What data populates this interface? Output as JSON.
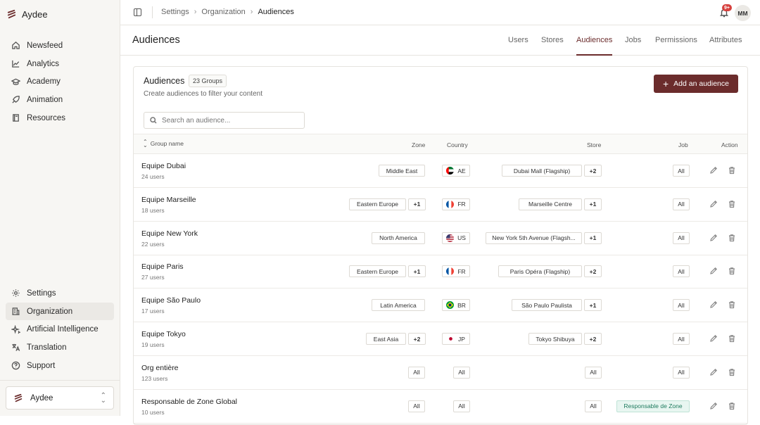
{
  "app": {
    "name": "Aydee"
  },
  "sidebar": {
    "top_items": [
      {
        "label": "Newsfeed",
        "icon": "home-icon"
      },
      {
        "label": "Analytics",
        "icon": "chart-icon"
      },
      {
        "label": "Academy",
        "icon": "graduation-cap-icon"
      },
      {
        "label": "Animation",
        "icon": "rocket-icon"
      },
      {
        "label": "Resources",
        "icon": "book-icon"
      }
    ],
    "bottom_items": [
      {
        "label": "Settings",
        "icon": "gear-icon"
      },
      {
        "label": "Organization",
        "icon": "building-icon",
        "active": true
      },
      {
        "label": "Artificial Intelligence",
        "icon": "sparkle-icon"
      },
      {
        "label": "Translation",
        "icon": "translate-icon"
      },
      {
        "label": "Support",
        "icon": "help-circle-icon"
      }
    ],
    "workspace": "Aydee"
  },
  "topbar": {
    "breadcrumb": [
      "Settings",
      "Organization",
      "Audiences"
    ],
    "notification_badge": "9+",
    "avatar_initials": "MM"
  },
  "page": {
    "title": "Audiences",
    "tabs": [
      {
        "label": "Users"
      },
      {
        "label": "Stores"
      },
      {
        "label": "Audiences",
        "active": true
      },
      {
        "label": "Jobs"
      },
      {
        "label": "Permissions"
      },
      {
        "label": "Attributes"
      }
    ]
  },
  "card": {
    "title": "Audiences",
    "count": "23 Groups",
    "subtitle": "Create audiences to filter your content",
    "add_button": "Add an audience",
    "search_placeholder": "Search an audience...",
    "columns": {
      "group": "Group name",
      "zone": "Zone",
      "country": "Country",
      "store": "Store",
      "job": "Job",
      "action": "Action"
    }
  },
  "colors": {
    "accent": "#6b2c2c",
    "badge": "#d6403d",
    "green_chip": "#e8f6f1"
  },
  "rows": [
    {
      "name": "Equipe Dubai",
      "users": "24 users",
      "zone": "Middle East",
      "zone_more": "",
      "country": "AE",
      "flag": "ae",
      "store": "Dubai Mall (Flagship)",
      "store_more": "+2",
      "job": "All"
    },
    {
      "name": "Equipe Marseille",
      "users": "18 users",
      "zone": "Eastern Europe",
      "zone_more": "+1",
      "country": "FR",
      "flag": "fr",
      "store": "Marseille Centre",
      "store_more": "+1",
      "job": "All"
    },
    {
      "name": "Equipe New York",
      "users": "22 users",
      "zone": "North America",
      "zone_more": "",
      "country": "US",
      "flag": "us",
      "store": "New York 5th Avenue (Flagsh...",
      "store_more": "+1",
      "job": "All"
    },
    {
      "name": "Equipe Paris",
      "users": "27 users",
      "zone": "Eastern Europe",
      "zone_more": "+1",
      "country": "FR",
      "flag": "fr",
      "store": "Paris Opéra (Flagship)",
      "store_more": "+2",
      "job": "All"
    },
    {
      "name": "Equipe São Paulo",
      "users": "17 users",
      "zone": "Latin America",
      "zone_more": "",
      "country": "BR",
      "flag": "br",
      "store": "São Paulo Paulista",
      "store_more": "+1",
      "job": "All"
    },
    {
      "name": "Equipe Tokyo",
      "users": "19 users",
      "zone": "East Asia",
      "zone_more": "+2",
      "country": "JP",
      "flag": "jp",
      "store": "Tokyo Shibuya",
      "store_more": "+2",
      "job": "All"
    },
    {
      "name": "Org entière",
      "users": "123 users",
      "zone": "All",
      "zone_more": "",
      "country": "All",
      "flag": "",
      "store": "All",
      "store_more": "",
      "job": "All"
    },
    {
      "name": "Responsable de Zone Global",
      "users": "10 users",
      "zone": "All",
      "zone_more": "",
      "country": "All",
      "flag": "",
      "store": "All",
      "store_more": "",
      "job": "Responsable de Zone",
      "job_style": "green"
    }
  ]
}
